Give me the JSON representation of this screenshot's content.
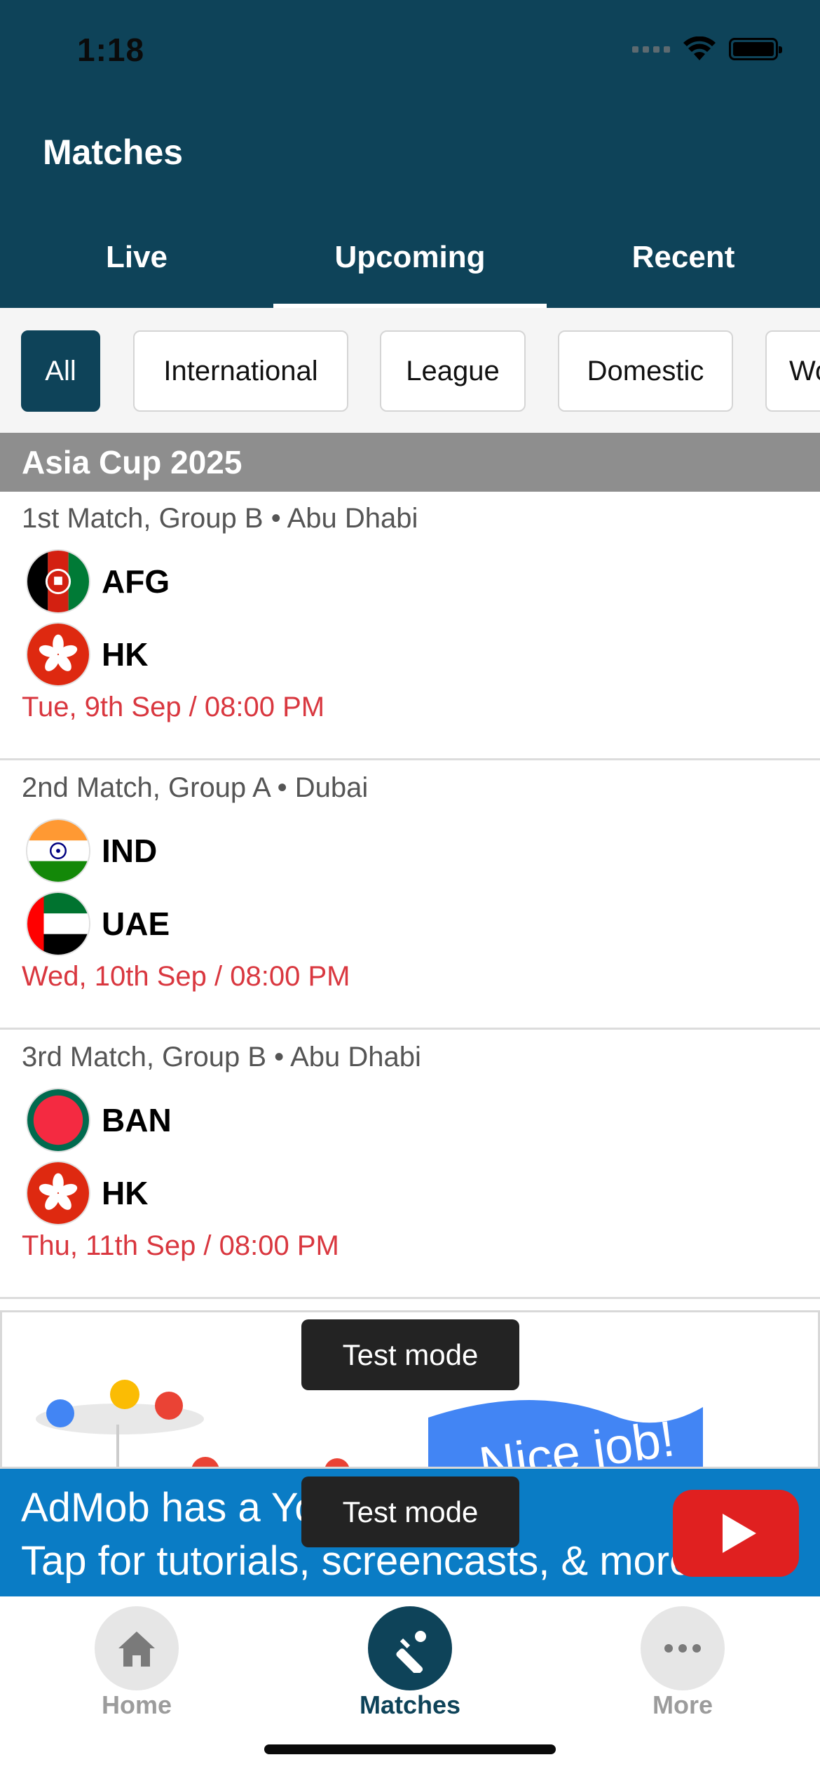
{
  "status_bar": {
    "time": "1:18"
  },
  "header": {
    "title": "Matches"
  },
  "tabs": [
    {
      "label": "Live",
      "active": false
    },
    {
      "label": "Upcoming",
      "active": true
    },
    {
      "label": "Recent",
      "active": false
    }
  ],
  "filters": [
    {
      "label": "All",
      "active": true
    },
    {
      "label": "International",
      "active": false
    },
    {
      "label": "League",
      "active": false
    },
    {
      "label": "Domestic",
      "active": false
    },
    {
      "label": "Wo",
      "active": false
    }
  ],
  "section": {
    "title": "Asia Cup 2025"
  },
  "matches": [
    {
      "info": "1st Match, Group B • Abu Dhabi",
      "team1": {
        "name": "AFG",
        "flag": "afghanistan-flag-icon"
      },
      "team2": {
        "name": "HK",
        "flag": "hong-kong-flag-icon"
      },
      "time": "Tue, 9th Sep / 08:00 PM"
    },
    {
      "info": "2nd Match, Group A • Dubai",
      "team1": {
        "name": "IND",
        "flag": "india-flag-icon"
      },
      "team2": {
        "name": "UAE",
        "flag": "uae-flag-icon"
      },
      "time": "Wed, 10th Sep / 08:00 PM"
    },
    {
      "info": "3rd Match, Group B • Abu Dhabi",
      "team1": {
        "name": "BAN",
        "flag": "bangladesh-flag-icon"
      },
      "team2": {
        "name": "HK",
        "flag": "hong-kong-flag-icon"
      },
      "time": "Thu, 11th Sep / 08:00 PM"
    }
  ],
  "ad": {
    "badge": "Test mode",
    "line1": "AdMob has a You",
    "line2": "Tap for tutorials, screencasts, & more.",
    "banner_text": "Nice job!"
  },
  "bottom_nav": [
    {
      "label": "Home",
      "icon": "home-icon",
      "active": false
    },
    {
      "label": "Matches",
      "icon": "cricket-bat-icon",
      "active": true
    },
    {
      "label": "More",
      "icon": "more-dots-icon",
      "active": false
    }
  ],
  "colors": {
    "primary": "#0e4359",
    "match_time": "#d9373f",
    "section_bg": "#8e8e8e",
    "ad_blue": "#0a7cc5"
  }
}
